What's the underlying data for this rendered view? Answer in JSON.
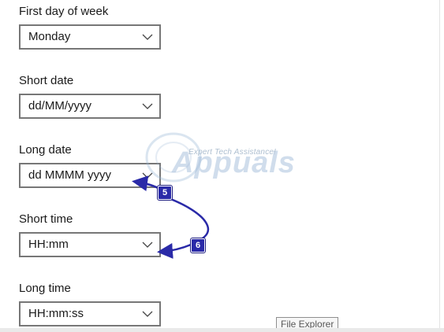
{
  "settings": {
    "first_day_of_week": {
      "label": "First day of week",
      "value": "Monday"
    },
    "short_date": {
      "label": "Short date",
      "value": "dd/MM/yyyy"
    },
    "long_date": {
      "label": "Long date",
      "value": "dd MMMM yyyy"
    },
    "short_time": {
      "label": "Short time",
      "value": "HH:mm"
    },
    "long_time": {
      "label": "Long time",
      "value": "HH:mm:ss"
    }
  },
  "watermark": {
    "tagline": "Expert Tech Assistance!",
    "logo_text": "Appuals"
  },
  "annotations": {
    "step_5": "5",
    "step_6": "6",
    "color": "#2a2aa8"
  },
  "tooltip": {
    "text": "File Explorer"
  },
  "icons": {
    "dropdown_arrow": "chevron-down-icon"
  }
}
